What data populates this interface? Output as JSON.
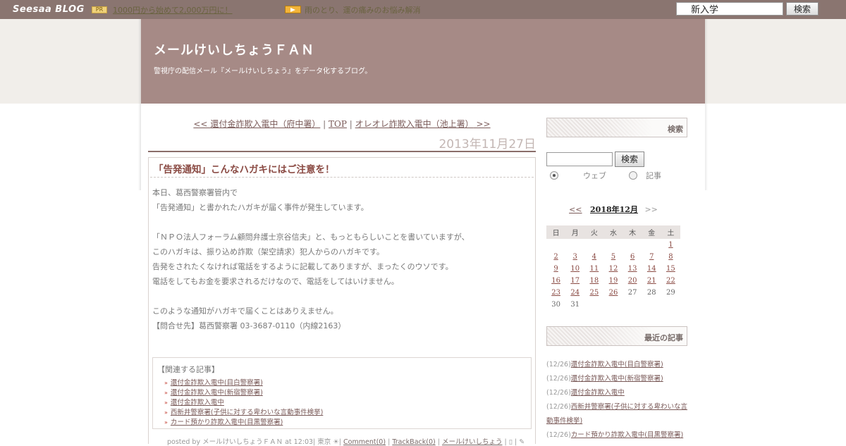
{
  "topbar": {
    "logo": "Seesaa BLOG",
    "pr_badge": "PR",
    "pr_link": "1000円から始めて2,000万円に！",
    "notice": "雨のとり、運の痛みのお悩み解消",
    "search_value": "新入学",
    "search_button": "検索"
  },
  "header": {
    "title": "メールけいしちょうＦＡＮ",
    "description": "警視庁の配信メール『メールけいしちょう』をデータ化するブログ。"
  },
  "nav": {
    "prev_marker": "<<",
    "prev_label": "還付金詐欺入電中（府中署）",
    "sep1": "|",
    "top_label": "TOP",
    "sep2": "|",
    "next_label": "オレオレ詐欺入電中（池上署）",
    "next_marker": ">>"
  },
  "entry": {
    "date": "2013年11月27日",
    "title": "「告発通知」こんなハガキにはご注意を！",
    "body": [
      "本日、葛西警察署管内で",
      "「告発通知」と書かれたハガキが届く事件が発生しています。",
      "「ＮＰＯ法人フォーラム顧問弁護士京谷信夫」と、もっともらしいことを書いていますが、",
      "このハガキは、振り込め詐欺（架空請求）犯人からのハガキです。",
      "告発をされたくなければ電話をするように記載してありますが、まったくのウソです。",
      "電話をしてもお金を要求されるだけなので、電話をしてはいけません。",
      "このような通知がハガキで届くことはありえません。",
      "【問合せ先】葛西警察署 03-3687-0110（内線2163）"
    ],
    "related_heading": "【関連する記事】",
    "related": [
      "還付金詐欺入電中(目白警察署)",
      "還付金詐欺入電中(新宿警察署)",
      "還付金詐欺入電中",
      "西新井警察署(子供に対する卑わいな言動事件検挙)",
      "カード預かり詐欺入電中(目黒警察署)"
    ],
    "footer": {
      "posted_by": "posted by メールけいしちょうＦＡＮ at 12:03| 東京 ☀|",
      "comment": "Comment(0)",
      "trackback": "TrackBack(0)",
      "category": "メールけいしちょう"
    }
  },
  "sidebar": {
    "search_heading": "検索",
    "search_button": "検索",
    "radio_web": "ウェブ",
    "radio_article": "記事",
    "calendar": {
      "prev": "<<",
      "current": "2018年12月",
      "next": ">>",
      "weekdays": [
        "日",
        "月",
        "火",
        "水",
        "木",
        "金",
        "土"
      ],
      "weeks": [
        [
          "",
          "",
          "",
          "",
          "",
          "",
          "1"
        ],
        [
          "2",
          "3",
          "4",
          "5",
          "6",
          "7",
          "8"
        ],
        [
          "9",
          "10",
          "11",
          "12",
          "13",
          "14",
          "15"
        ],
        [
          "16",
          "17",
          "18",
          "19",
          "20",
          "21",
          "22"
        ],
        [
          "23",
          "24",
          "25",
          "26",
          "27",
          "28",
          "29"
        ],
        [
          "30",
          "31",
          "",
          "",
          "",
          "",
          ""
        ]
      ],
      "linked_days": [
        "1",
        "2",
        "3",
        "4",
        "5",
        "6",
        "7",
        "8",
        "9",
        "10",
        "11",
        "12",
        "13",
        "14",
        "15",
        "16",
        "17",
        "18",
        "19",
        "20",
        "21",
        "22",
        "23",
        "24",
        "25",
        "26"
      ]
    },
    "recent_heading": "最近の記事",
    "recent": [
      {
        "date": "(12/26)",
        "title": "還付金詐欺入電中(目白警察署)"
      },
      {
        "date": "(12/26)",
        "title": "還付金詐欺入電中(新宿警察署)"
      },
      {
        "date": "(12/26)",
        "title": "還付金詐欺入電中"
      },
      {
        "date": "(12/26)",
        "title": "西新井警察署(子供に対する卑わいな言動事件検挙)"
      },
      {
        "date": "(12/26)",
        "title": "カード預かり詐欺入電中(目黒警察署)"
      }
    ]
  }
}
